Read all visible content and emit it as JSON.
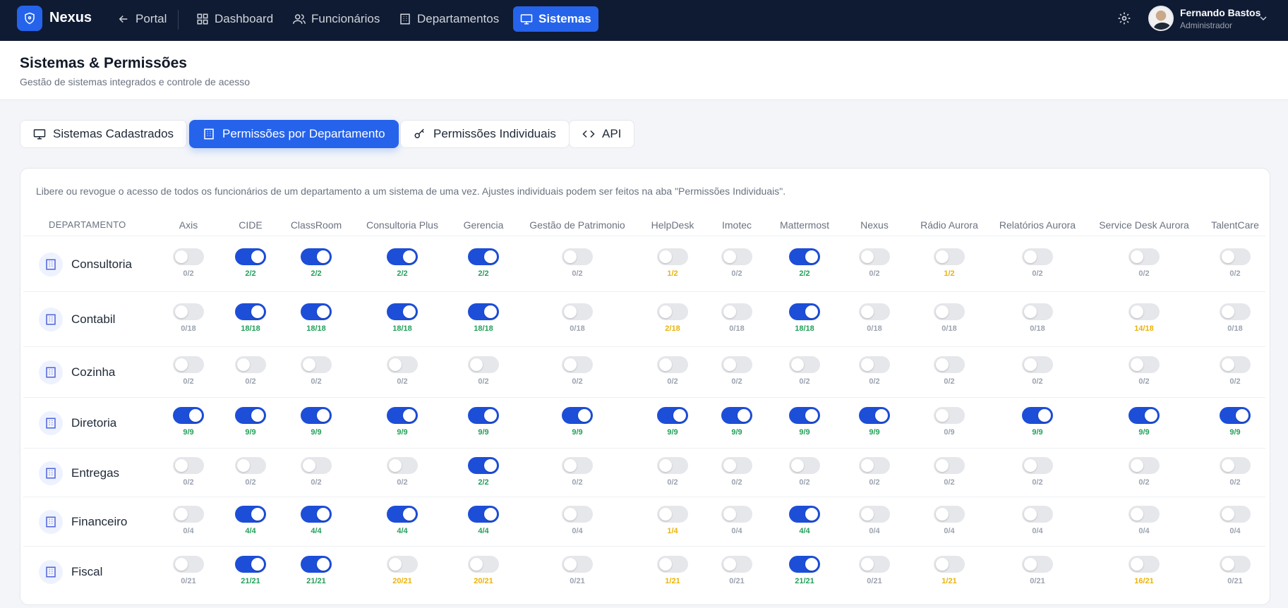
{
  "nav": {
    "brand": "Nexus",
    "items": [
      {
        "label": "Portal",
        "icon": "arrow-left-icon",
        "active": false
      },
      {
        "label": "Dashboard",
        "icon": "grid-icon",
        "active": false
      },
      {
        "label": "Funcionários",
        "icon": "users-icon",
        "active": false
      },
      {
        "label": "Departamentos",
        "icon": "building-icon",
        "active": false
      },
      {
        "label": "Sistemas",
        "icon": "monitor-icon",
        "active": true
      }
    ],
    "user": {
      "name": "Fernando Bastos",
      "role": "Administrador"
    }
  },
  "header": {
    "title": "Sistemas & Permissões",
    "subtitle": "Gestão de sistemas integrados e controle de acesso"
  },
  "tabs": [
    {
      "label": "Sistemas Cadastrados",
      "icon": "monitor-icon",
      "active": false
    },
    {
      "label": "Permissões por Departamento",
      "icon": "building-icon",
      "active": true
    },
    {
      "label": "Permissões Individuais",
      "icon": "key-icon",
      "active": false
    },
    {
      "label": "API",
      "icon": "code-icon",
      "active": false
    }
  ],
  "info": "Libere ou revogue o acesso de todos os funcionários de um departamento a um sistema de uma vez. Ajustes individuais podem ser feitos na aba \"Permissões Individuais\".",
  "table": {
    "dept_header": "DEPARTAMENTO",
    "systems": [
      "Axis",
      "CIDE",
      "ClassRoom",
      "Consultoria Plus",
      "Gerencia",
      "Gestão de Patrimonio",
      "HelpDesk",
      "Imotec",
      "Mattermost",
      "Nexus",
      "Rádio Aurora",
      "Relatórios Aurora",
      "Service Desk Aurora",
      "TalentCare"
    ],
    "rows": [
      {
        "dept": "Consultoria",
        "cells": [
          {
            "on": false,
            "count": "0/2",
            "status": "none"
          },
          {
            "on": true,
            "count": "2/2",
            "status": "full"
          },
          {
            "on": true,
            "count": "2/2",
            "status": "full"
          },
          {
            "on": true,
            "count": "2/2",
            "status": "full"
          },
          {
            "on": true,
            "count": "2/2",
            "status": "full"
          },
          {
            "on": false,
            "count": "0/2",
            "status": "none"
          },
          {
            "on": false,
            "count": "1/2",
            "status": "partial"
          },
          {
            "on": false,
            "count": "0/2",
            "status": "none"
          },
          {
            "on": true,
            "count": "2/2",
            "status": "full"
          },
          {
            "on": false,
            "count": "0/2",
            "status": "none"
          },
          {
            "on": false,
            "count": "1/2",
            "status": "partial"
          },
          {
            "on": false,
            "count": "0/2",
            "status": "none"
          },
          {
            "on": false,
            "count": "0/2",
            "status": "none"
          },
          {
            "on": false,
            "count": "0/2",
            "status": "none"
          }
        ]
      },
      {
        "dept": "Contabil",
        "cells": [
          {
            "on": false,
            "count": "0/18",
            "status": "none"
          },
          {
            "on": true,
            "count": "18/18",
            "status": "full"
          },
          {
            "on": true,
            "count": "18/18",
            "status": "full"
          },
          {
            "on": true,
            "count": "18/18",
            "status": "full"
          },
          {
            "on": true,
            "count": "18/18",
            "status": "full"
          },
          {
            "on": false,
            "count": "0/18",
            "status": "none"
          },
          {
            "on": false,
            "count": "2/18",
            "status": "partial"
          },
          {
            "on": false,
            "count": "0/18",
            "status": "none"
          },
          {
            "on": true,
            "count": "18/18",
            "status": "full"
          },
          {
            "on": false,
            "count": "0/18",
            "status": "none"
          },
          {
            "on": false,
            "count": "0/18",
            "status": "none"
          },
          {
            "on": false,
            "count": "0/18",
            "status": "none"
          },
          {
            "on": false,
            "count": "14/18",
            "status": "partial"
          },
          {
            "on": false,
            "count": "0/18",
            "status": "none"
          }
        ]
      },
      {
        "dept": "Cozinha",
        "cells": [
          {
            "on": false,
            "count": "0/2",
            "status": "none"
          },
          {
            "on": false,
            "count": "0/2",
            "status": "none"
          },
          {
            "on": false,
            "count": "0/2",
            "status": "none"
          },
          {
            "on": false,
            "count": "0/2",
            "status": "none"
          },
          {
            "on": false,
            "count": "0/2",
            "status": "none"
          },
          {
            "on": false,
            "count": "0/2",
            "status": "none"
          },
          {
            "on": false,
            "count": "0/2",
            "status": "none"
          },
          {
            "on": false,
            "count": "0/2",
            "status": "none"
          },
          {
            "on": false,
            "count": "0/2",
            "status": "none"
          },
          {
            "on": false,
            "count": "0/2",
            "status": "none"
          },
          {
            "on": false,
            "count": "0/2",
            "status": "none"
          },
          {
            "on": false,
            "count": "0/2",
            "status": "none"
          },
          {
            "on": false,
            "count": "0/2",
            "status": "none"
          },
          {
            "on": false,
            "count": "0/2",
            "status": "none"
          }
        ]
      },
      {
        "dept": "Diretoria",
        "cells": [
          {
            "on": true,
            "count": "9/9",
            "status": "full"
          },
          {
            "on": true,
            "count": "9/9",
            "status": "full"
          },
          {
            "on": true,
            "count": "9/9",
            "status": "full"
          },
          {
            "on": true,
            "count": "9/9",
            "status": "full"
          },
          {
            "on": true,
            "count": "9/9",
            "status": "full"
          },
          {
            "on": true,
            "count": "9/9",
            "status": "full"
          },
          {
            "on": true,
            "count": "9/9",
            "status": "full"
          },
          {
            "on": true,
            "count": "9/9",
            "status": "full"
          },
          {
            "on": true,
            "count": "9/9",
            "status": "full"
          },
          {
            "on": true,
            "count": "9/9",
            "status": "full"
          },
          {
            "on": false,
            "count": "0/9",
            "status": "none"
          },
          {
            "on": true,
            "count": "9/9",
            "status": "full"
          },
          {
            "on": true,
            "count": "9/9",
            "status": "full"
          },
          {
            "on": true,
            "count": "9/9",
            "status": "full"
          }
        ]
      },
      {
        "dept": "Entregas",
        "cells": [
          {
            "on": false,
            "count": "0/2",
            "status": "none"
          },
          {
            "on": false,
            "count": "0/2",
            "status": "none"
          },
          {
            "on": false,
            "count": "0/2",
            "status": "none"
          },
          {
            "on": false,
            "count": "0/2",
            "status": "none"
          },
          {
            "on": true,
            "count": "2/2",
            "status": "full"
          },
          {
            "on": false,
            "count": "0/2",
            "status": "none"
          },
          {
            "on": false,
            "count": "0/2",
            "status": "none"
          },
          {
            "on": false,
            "count": "0/2",
            "status": "none"
          },
          {
            "on": false,
            "count": "0/2",
            "status": "none"
          },
          {
            "on": false,
            "count": "0/2",
            "status": "none"
          },
          {
            "on": false,
            "count": "0/2",
            "status": "none"
          },
          {
            "on": false,
            "count": "0/2",
            "status": "none"
          },
          {
            "on": false,
            "count": "0/2",
            "status": "none"
          },
          {
            "on": false,
            "count": "0/2",
            "status": "none"
          }
        ]
      },
      {
        "dept": "Financeiro",
        "cells": [
          {
            "on": false,
            "count": "0/4",
            "status": "none"
          },
          {
            "on": true,
            "count": "4/4",
            "status": "full"
          },
          {
            "on": true,
            "count": "4/4",
            "status": "full"
          },
          {
            "on": true,
            "count": "4/4",
            "status": "full"
          },
          {
            "on": true,
            "count": "4/4",
            "status": "full"
          },
          {
            "on": false,
            "count": "0/4",
            "status": "none"
          },
          {
            "on": false,
            "count": "1/4",
            "status": "partial"
          },
          {
            "on": false,
            "count": "0/4",
            "status": "none"
          },
          {
            "on": true,
            "count": "4/4",
            "status": "full"
          },
          {
            "on": false,
            "count": "0/4",
            "status": "none"
          },
          {
            "on": false,
            "count": "0/4",
            "status": "none"
          },
          {
            "on": false,
            "count": "0/4",
            "status": "none"
          },
          {
            "on": false,
            "count": "0/4",
            "status": "none"
          },
          {
            "on": false,
            "count": "0/4",
            "status": "none"
          }
        ]
      },
      {
        "dept": "Fiscal",
        "cells": [
          {
            "on": false,
            "count": "0/21",
            "status": "none"
          },
          {
            "on": true,
            "count": "21/21",
            "status": "full"
          },
          {
            "on": true,
            "count": "21/21",
            "status": "full"
          },
          {
            "on": false,
            "count": "20/21",
            "status": "partial"
          },
          {
            "on": false,
            "count": "20/21",
            "status": "partial"
          },
          {
            "on": false,
            "count": "0/21",
            "status": "none"
          },
          {
            "on": false,
            "count": "1/21",
            "status": "partial"
          },
          {
            "on": false,
            "count": "0/21",
            "status": "none"
          },
          {
            "on": true,
            "count": "21/21",
            "status": "full"
          },
          {
            "on": false,
            "count": "0/21",
            "status": "none"
          },
          {
            "on": false,
            "count": "1/21",
            "status": "partial"
          },
          {
            "on": false,
            "count": "0/21",
            "status": "none"
          },
          {
            "on": false,
            "count": "16/21",
            "status": "partial"
          },
          {
            "on": false,
            "count": "0/21",
            "status": "none"
          }
        ]
      }
    ]
  },
  "colors": {
    "accent": "#2563eb",
    "nav_bg": "#0f1b33",
    "full": "#22a05a",
    "partial": "#eab308",
    "none": "#9ca3af"
  }
}
